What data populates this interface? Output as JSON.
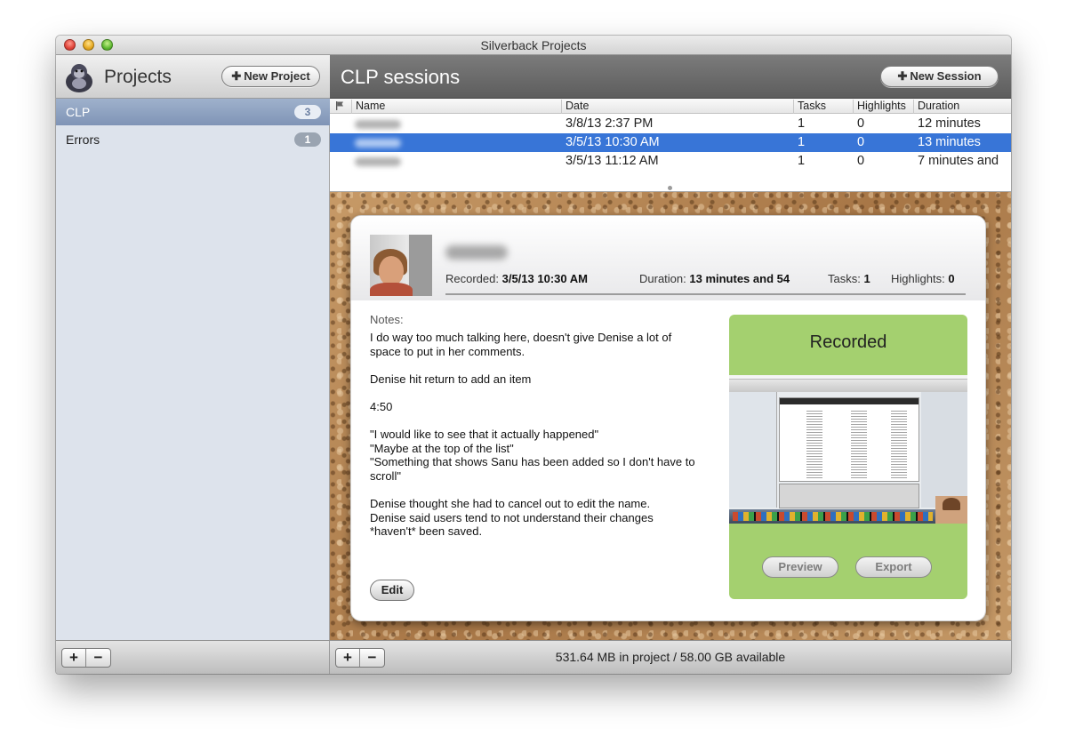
{
  "window": {
    "title": "Silverback Projects"
  },
  "sidebar": {
    "title": "Projects",
    "new_project_label": "New Project",
    "projects": [
      {
        "name": "CLP",
        "count": "3",
        "selected": true
      },
      {
        "name": "Errors",
        "count": "1",
        "selected": false
      }
    ]
  },
  "main": {
    "title": "CLP sessions",
    "new_session_label": "New Session"
  },
  "sessions_table": {
    "columns": [
      "Name",
      "Date",
      "Tasks",
      "Highlights",
      "Duration"
    ],
    "rows": [
      {
        "date": "3/8/13 2:37 PM",
        "tasks": "1",
        "highlights": "0",
        "duration": "12 minutes",
        "selected": false
      },
      {
        "date": "3/5/13 10:30 AM",
        "tasks": "1",
        "highlights": "0",
        "duration": "13 minutes",
        "selected": true
      },
      {
        "date": "3/5/13 11:12 AM",
        "tasks": "1",
        "highlights": "0",
        "duration": "7 minutes and",
        "selected": false
      }
    ]
  },
  "detail": {
    "recorded_label": "Recorded:",
    "recorded_value": "3/5/13 10:30 AM",
    "duration_label": "Duration:",
    "duration_value": "13 minutes and 54",
    "tasks_label": "Tasks:",
    "tasks_value": "1",
    "highlights_label": "Highlights:",
    "highlights_value": "0",
    "notes_label": "Notes:",
    "notes_lines": [
      "I do way too much talking here, doesn't give Denise a lot of",
      "space to put in her comments.",
      "",
      "Denise hit return to add an item",
      "",
      "4:50",
      "",
      "\"I would like to see that it actually happened\"",
      "\"Maybe at the top of the list\"",
      "\"Something that shows Sanu has been added so I don't have to",
      "scroll\"",
      "",
      "Denise thought she had to cancel out to edit the name.",
      "Denise said users tend to not understand their changes",
      "*haven't* been saved."
    ],
    "edit_label": "Edit",
    "status_title": "Recorded",
    "preview_label": "Preview",
    "export_label": "Export"
  },
  "footer": {
    "plus": "+",
    "minus": "−",
    "storage_text": "531.64 MB in project / 58.00 GB available"
  },
  "icons": {
    "app_logo": "silverback-gorilla-icon",
    "flag": "flag-icon",
    "add": "plus-icon",
    "remove": "minus-icon"
  },
  "colors": {
    "selection_blue": "#3875d7",
    "sidebar_selection": "#8a9dbd",
    "recorded_green": "#a4d06f"
  }
}
